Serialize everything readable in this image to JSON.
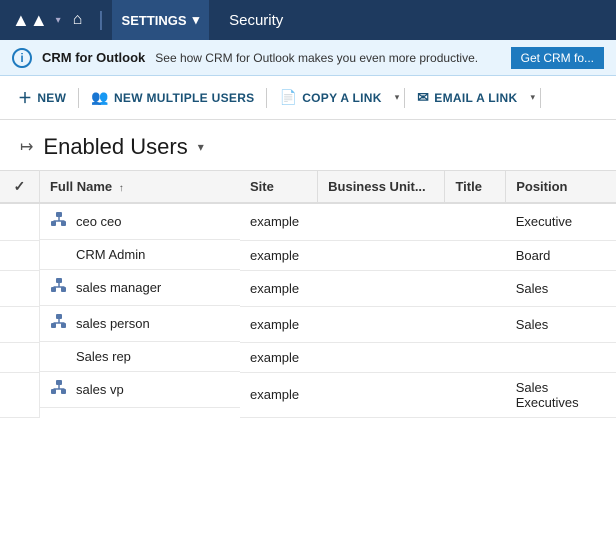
{
  "nav": {
    "logo": "▲▲",
    "home_icon": "⌂",
    "settings_label": "SETTINGS",
    "page_title": "Security",
    "caret": "▾"
  },
  "banner": {
    "icon_text": "i",
    "title": "CRM for Outlook",
    "text": "See how CRM for Outlook makes you even more productive.",
    "button_label": "Get CRM fo..."
  },
  "toolbar": {
    "new_label": "NEW",
    "new_multiple_label": "NEW MULTIPLE USERS",
    "copy_link_label": "COPY A LINK",
    "email_link_label": "EMAIL A LINK"
  },
  "heading": {
    "title": "Enabled Users",
    "pin_icon": "→",
    "caret": "▾"
  },
  "table": {
    "columns": [
      "",
      "Full Name",
      "Site",
      "Business Unit...",
      "Title",
      "Position"
    ],
    "rows": [
      {
        "icon": true,
        "name": "ceo ceo",
        "site": "example",
        "business_unit": "",
        "title": "",
        "position": "Executive"
      },
      {
        "icon": false,
        "name": "CRM Admin",
        "site": "example",
        "business_unit": "",
        "title": "",
        "position": "Board"
      },
      {
        "icon": true,
        "name": "sales manager",
        "site": "example",
        "business_unit": "",
        "title": "",
        "position": "Sales"
      },
      {
        "icon": true,
        "name": "sales person",
        "site": "example",
        "business_unit": "",
        "title": "",
        "position": "Sales"
      },
      {
        "icon": false,
        "name": "Sales rep",
        "site": "example",
        "business_unit": "",
        "title": "",
        "position": ""
      },
      {
        "icon": true,
        "name": "sales vp",
        "site": "example",
        "business_unit": "",
        "title": "",
        "position": "Sales Executives"
      }
    ]
  }
}
